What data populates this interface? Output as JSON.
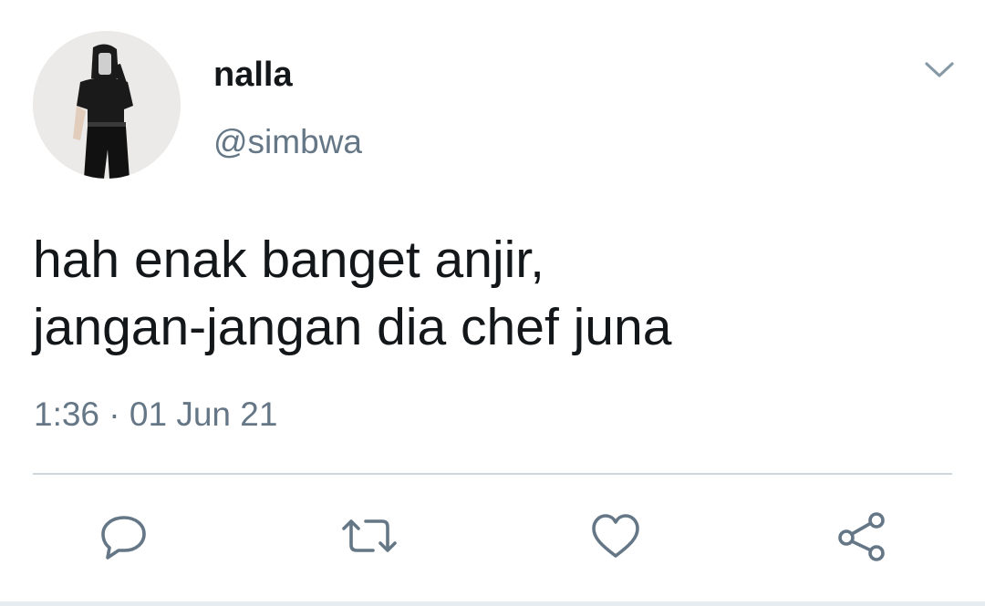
{
  "tweet": {
    "author": {
      "display_name": "nalla",
      "handle": "@simbwa",
      "avatar_icon": "profile-photo"
    },
    "text_lines": [
      "hah enak banget anjir,",
      "jangan-jangan dia chef juna"
    ],
    "timestamp": "1:36 · 01 Jun 21",
    "menu_icon": "chevron-down-icon",
    "actions": [
      {
        "name": "reply",
        "icon": "comment-icon"
      },
      {
        "name": "retweet",
        "icon": "retweet-icon"
      },
      {
        "name": "like",
        "icon": "heart-icon"
      },
      {
        "name": "share",
        "icon": "share-icon"
      }
    ]
  },
  "colors": {
    "text_primary": "#14171a",
    "text_secondary": "#657786",
    "icon": "#657786",
    "divider": "#ccd6dd",
    "background": "#ffffff"
  }
}
